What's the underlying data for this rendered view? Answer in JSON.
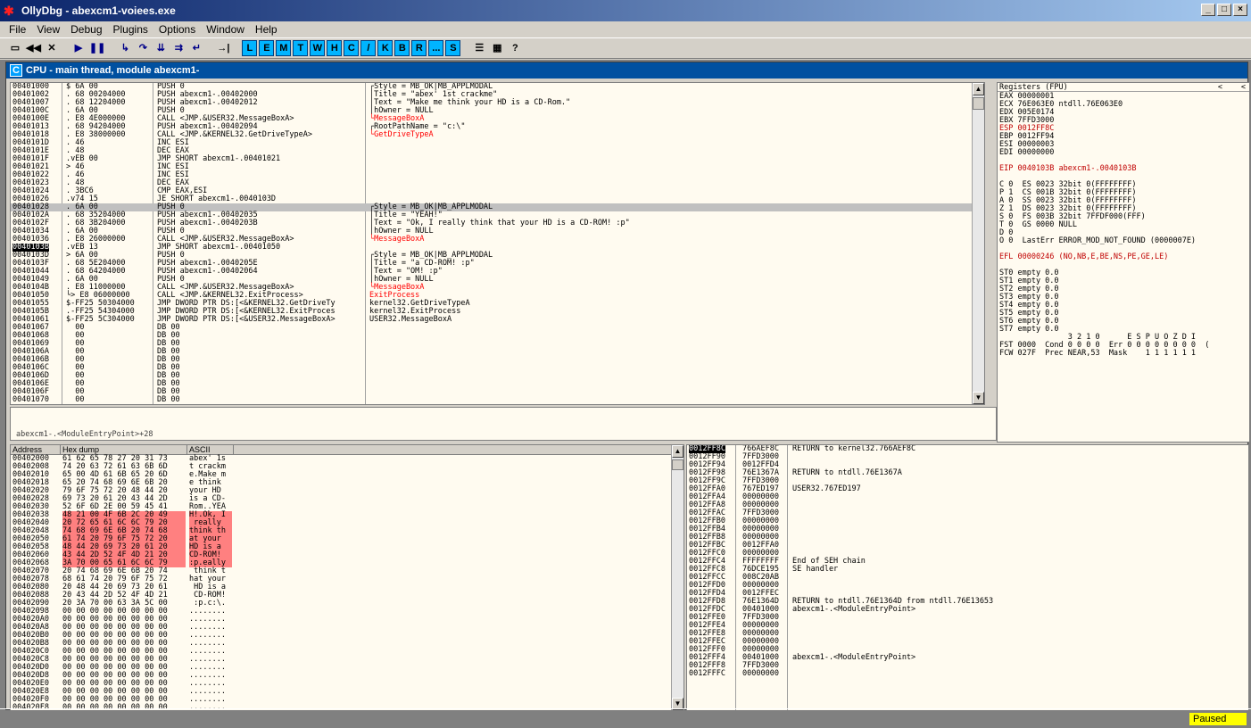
{
  "window": {
    "title": "OllyDbg - abexcm1-voiees.exe"
  },
  "menu": [
    "File",
    "View",
    "Debug",
    "Plugins",
    "Options",
    "Window",
    "Help"
  ],
  "toolbar": {
    "letters": [
      "L",
      "E",
      "M",
      "T",
      "W",
      "H",
      "C",
      "/",
      "K",
      "B",
      "R",
      "...",
      "S"
    ]
  },
  "cpu": {
    "title": "CPU - main thread, module abexcm1-",
    "icon": "C"
  },
  "disasm": {
    "rows": [
      {
        "addr": "00401000",
        "hex": "$ 6A 00",
        "asm": "PUSH 0",
        "cmt": "┌Style = MB_OK|MB_APPLMODAL"
      },
      {
        "addr": "00401002",
        "hex": ". 68 00204000",
        "asm": "PUSH abexcm1-.00402000",
        "cmt": "|Title = \"abex' 1st crackme\""
      },
      {
        "addr": "00401007",
        "hex": ". 68 12204000",
        "asm": "PUSH abexcm1-.00402012",
        "cmt": "|Text = \"Make me think your HD is a CD-Rom.\""
      },
      {
        "addr": "0040100C",
        "hex": ". 6A 00",
        "asm": "PUSH 0",
        "cmt": "|hOwner = NULL"
      },
      {
        "addr": "0040100E",
        "hex": ". E8 4E000000",
        "asm": "CALL <JMP.&USER32.MessageBoxA>",
        "cmt": "└MessageBoxA"
      },
      {
        "addr": "00401013",
        "hex": ". 68 94204000",
        "asm": "PUSH abexcm1-.00402094",
        "cmt": "┌RootPathName = \"c:\\\""
      },
      {
        "addr": "00401018",
        "hex": ". E8 38000000",
        "asm": "CALL <JMP.&KERNEL32.GetDriveTypeA>",
        "cmt": "└GetDriveTypeA"
      },
      {
        "addr": "0040101D",
        "hex": ". 46",
        "asm": "INC ESI",
        "cmt": ""
      },
      {
        "addr": "0040101E",
        "hex": ". 48",
        "asm": "DEC EAX",
        "cmt": ""
      },
      {
        "addr": "0040101F",
        "hex": ".vEB 00",
        "asm": "JMP SHORT abexcm1-.00401021",
        "cmt": ""
      },
      {
        "addr": "00401021",
        "hex": "> 46",
        "asm": "INC ESI",
        "cmt": ""
      },
      {
        "addr": "00401022",
        "hex": ". 46",
        "asm": "INC ESI",
        "cmt": ""
      },
      {
        "addr": "00401023",
        "hex": ". 48",
        "asm": "DEC EAX",
        "cmt": ""
      },
      {
        "addr": "00401024",
        "hex": ". 3BC6",
        "asm": "CMP EAX,ESI",
        "cmt": ""
      },
      {
        "addr": "00401026",
        "hex": ".v74 15",
        "asm": "JE SHORT abexcm1-.0040103D",
        "cmt": ""
      },
      {
        "addr": "00401028",
        "hex": ". 6A 00",
        "asm": "PUSH 0",
        "cmt": "┌Style = MB_OK|MB_APPLMODAL"
      },
      {
        "addr": "0040102A",
        "hex": ". 68 35204000",
        "asm": "PUSH abexcm1-.00402035",
        "cmt": "|Title = \"YEAH!\""
      },
      {
        "addr": "0040102F",
        "hex": ". 68 3B204000",
        "asm": "PUSH abexcm1-.0040203B",
        "cmt": "|Text = \"Ok, I really think that your HD is a CD-ROM! :p\""
      },
      {
        "addr": "00401034",
        "hex": ". 6A 00",
        "asm": "PUSH 0",
        "cmt": "|hOwner = NULL"
      },
      {
        "addr": "00401036",
        "hex": ". E8 26000000",
        "asm": "CALL <JMP.&USER32.MessageBoxA>",
        "cmt": "└MessageBoxA"
      },
      {
        "addr": "0040103B",
        "hex": ".vEB 13",
        "asm": "JMP SHORT abexcm1-.00401050",
        "cmt": ""
      },
      {
        "addr": "0040103D",
        "hex": "> 6A 00",
        "asm": "PUSH 0",
        "cmt": "┌Style = MB_OK|MB_APPLMODAL"
      },
      {
        "addr": "0040103F",
        "hex": ". 68 5E204000",
        "asm": "PUSH abexcm1-.0040205E",
        "cmt": "|Title = \"a CD-ROM! :p\""
      },
      {
        "addr": "00401044",
        "hex": ". 68 64204000",
        "asm": "PUSH abexcm1-.00402064",
        "cmt": "|Text = \"OM! :p\""
      },
      {
        "addr": "00401049",
        "hex": ". 6A 00",
        "asm": "PUSH 0",
        "cmt": "|hOwner = NULL"
      },
      {
        "addr": "0040104B",
        "hex": ". E8 11000000",
        "asm": "CALL <JMP.&USER32.MessageBoxA>",
        "cmt": "└MessageBoxA"
      },
      {
        "addr": "00401050",
        "hex": "└> E8 06000000",
        "asm": "CALL <JMP.&KERNEL32.ExitProcess>",
        "cmt": "ExitProcess"
      },
      {
        "addr": "00401055",
        "hex": "$-FF25 50304000",
        "asm": "JMP DWORD PTR DS:[<&KERNEL32.GetDriveTy",
        "cmt": "kernel32.GetDriveTypeA"
      },
      {
        "addr": "0040105B",
        "hex": ".-FF25 54304000",
        "asm": "JMP DWORD PTR DS:[<&KERNEL32.ExitProces",
        "cmt": "kernel32.ExitProcess"
      },
      {
        "addr": "00401061",
        "hex": "$-FF25 5C304000",
        "asm": "JMP DWORD PTR DS:[<&USER32.MessageBoxA>",
        "cmt": "USER32.MessageBoxA"
      },
      {
        "addr": "00401067",
        "hex": "  00",
        "asm": "DB 00",
        "cmt": ""
      },
      {
        "addr": "00401068",
        "hex": "  00",
        "asm": "DB 00",
        "cmt": ""
      },
      {
        "addr": "00401069",
        "hex": "  00",
        "asm": "DB 00",
        "cmt": ""
      },
      {
        "addr": "0040106A",
        "hex": "  00",
        "asm": "DB 00",
        "cmt": ""
      },
      {
        "addr": "0040106B",
        "hex": "  00",
        "asm": "DB 00",
        "cmt": ""
      },
      {
        "addr": "0040106C",
        "hex": "  00",
        "asm": "DB 00",
        "cmt": ""
      },
      {
        "addr": "0040106D",
        "hex": "  00",
        "asm": "DB 00",
        "cmt": ""
      },
      {
        "addr": "0040106E",
        "hex": "  00",
        "asm": "DB 00",
        "cmt": ""
      },
      {
        "addr": "0040106F",
        "hex": "  00",
        "asm": "DB 00",
        "cmt": ""
      },
      {
        "addr": "00401070",
        "hex": "  00",
        "asm": "DB 00",
        "cmt": ""
      }
    ]
  },
  "info": {
    "text": "abexcm1-.<ModuleEntryPoint>+28"
  },
  "registers": {
    "header": "Registers (FPU)",
    "lines": [
      "EAX 00000001",
      "ECX 76E063E0 ntdll.76E063E0",
      "EDX 005E0174",
      "EBX 7FFD3000",
      "ESP 0012FF8C",
      "EBP 0012FF94",
      "ESI 00000003",
      "EDI 00000000",
      "",
      "EIP 0040103B abexcm1-.0040103B",
      "",
      "C 0  ES 0023 32bit 0(FFFFFFFF)",
      "P 1  CS 001B 32bit 0(FFFFFFFF)",
      "A 0  SS 0023 32bit 0(FFFFFFFF)",
      "Z 1  DS 0023 32bit 0(FFFFFFFF)",
      "S 0  FS 003B 32bit 7FFDF000(FFF)",
      "T 0  GS 0000 NULL",
      "D 0",
      "O 0  LastErr ERROR_MOD_NOT_FOUND (0000007E)",
      "",
      "EFL 00000246 (NO,NB,E,BE,NS,PE,GE,LE)",
      "",
      "ST0 empty 0.0",
      "ST1 empty 0.0",
      "ST2 empty 0.0",
      "ST3 empty 0.0",
      "ST4 empty 0.0",
      "ST5 empty 0.0",
      "ST6 empty 0.0",
      "ST7 empty 0.0",
      "               3 2 1 0      E S P U O Z D I",
      "FST 0000  Cond 0 0 0 0  Err 0 0 0 0 0 0 0 0  (",
      "FCW 027F  Prec NEAR,53  Mask    1 1 1 1 1 1"
    ]
  },
  "dump": {
    "headers": [
      "Address",
      "Hex dump",
      "ASCII"
    ],
    "rows": [
      [
        "00402000",
        "61 62 65 78 27 20 31 73",
        "abex' 1s"
      ],
      [
        "00402008",
        "74 20 63 72 61 63 6B 6D",
        "t crackm"
      ],
      [
        "00402010",
        "65 00 4D 61 6B 65 20 6D",
        "e.Make m"
      ],
      [
        "00402018",
        "65 20 74 68 69 6E 6B 20",
        "e think "
      ],
      [
        "00402020",
        "79 6F 75 72 20 48 44 20",
        "your HD "
      ],
      [
        "00402028",
        "69 73 20 61 20 43 44 2D",
        "is a CD-"
      ],
      [
        "00402030",
        "52 6F 6D 2E 00 59 45 41",
        "Rom..YEA"
      ],
      [
        "00402038",
        "48 21 00 4F 6B 2C 20 49",
        "H!.Ok, I"
      ],
      [
        "00402040",
        "20 72 65 61 6C 6C 79 20",
        " really "
      ],
      [
        "00402048",
        "74 68 69 6E 6B 20 74 68",
        "think th"
      ],
      [
        "00402050",
        "61 74 20 79 6F 75 72 20",
        "at your "
      ],
      [
        "00402058",
        "48 44 20 69 73 20 61 20",
        "HD is a "
      ],
      [
        "00402060",
        "43 44 2D 52 4F 4D 21 20",
        "CD-ROM! "
      ],
      [
        "00402068",
        "3A 70 00 65 61 6C 6C 79",
        ":p.eally"
      ],
      [
        "00402070",
        "20 74 68 69 6E 6B 20 74",
        " think t"
      ],
      [
        "00402078",
        "68 61 74 20 79 6F 75 72",
        "hat your"
      ],
      [
        "00402080",
        "20 48 44 20 69 73 20 61",
        " HD is a"
      ],
      [
        "00402088",
        "20 43 44 2D 52 4F 4D 21",
        " CD-ROM!"
      ],
      [
        "00402090",
        "20 3A 70 00 63 3A 5C 00",
        " :p.c:\\."
      ],
      [
        "00402098",
        "00 00 00 00 00 00 00 00",
        "........"
      ],
      [
        "004020A0",
        "00 00 00 00 00 00 00 00",
        "........"
      ],
      [
        "004020A8",
        "00 00 00 00 00 00 00 00",
        "........"
      ],
      [
        "004020B0",
        "00 00 00 00 00 00 00 00",
        "........"
      ],
      [
        "004020B8",
        "00 00 00 00 00 00 00 00",
        "........"
      ],
      [
        "004020C0",
        "00 00 00 00 00 00 00 00",
        "........"
      ],
      [
        "004020C8",
        "00 00 00 00 00 00 00 00",
        "........"
      ],
      [
        "004020D0",
        "00 00 00 00 00 00 00 00",
        "........"
      ],
      [
        "004020D8",
        "00 00 00 00 00 00 00 00",
        "........"
      ],
      [
        "004020E0",
        "00 00 00 00 00 00 00 00",
        "........"
      ],
      [
        "004020E8",
        "00 00 00 00 00 00 00 00",
        "........"
      ],
      [
        "004020F0",
        "00 00 00 00 00 00 00 00",
        "........"
      ],
      [
        "004020F8",
        "00 00 00 00 00 00 00 00",
        "........"
      ]
    ]
  },
  "stack": {
    "rows": [
      [
        "0012FF8C",
        "766AEF8C",
        "RETURN to kernel32.766AEF8C"
      ],
      [
        "0012FF90",
        "7FFD3000",
        ""
      ],
      [
        "0012FF94",
        "0012FFD4",
        ""
      ],
      [
        "0012FF98",
        "76E1367A",
        "RETURN to ntdll.76E1367A"
      ],
      [
        "0012FF9C",
        "7FFD3000",
        ""
      ],
      [
        "0012FFA0",
        "767ED197",
        "USER32.767ED197"
      ],
      [
        "0012FFA4",
        "00000000",
        ""
      ],
      [
        "0012FFA8",
        "00000000",
        ""
      ],
      [
        "0012FFAC",
        "7FFD3000",
        ""
      ],
      [
        "0012FFB0",
        "00000000",
        ""
      ],
      [
        "0012FFB4",
        "00000000",
        ""
      ],
      [
        "0012FFB8",
        "00000000",
        ""
      ],
      [
        "0012FFBC",
        "0012FFA0",
        ""
      ],
      [
        "0012FFC0",
        "00000000",
        ""
      ],
      [
        "0012FFC4",
        "FFFFFFFF",
        "End of SEH chain"
      ],
      [
        "0012FFC8",
        "76DCE195",
        "SE handler"
      ],
      [
        "0012FFCC",
        "008C20AB",
        ""
      ],
      [
        "0012FFD0",
        "00000000",
        ""
      ],
      [
        "0012FFD4",
        "0012FFEC",
        ""
      ],
      [
        "0012FFD8",
        "76E1364D",
        "RETURN to ntdll.76E1364D from ntdll.76E13653"
      ],
      [
        "0012FFDC",
        "00401000",
        "abexcm1-.<ModuleEntryPoint>"
      ],
      [
        "0012FFE0",
        "7FFD3000",
        ""
      ],
      [
        "0012FFE4",
        "00000000",
        ""
      ],
      [
        "0012FFE8",
        "00000000",
        ""
      ],
      [
        "0012FFEC",
        "00000000",
        ""
      ],
      [
        "0012FFF0",
        "00000000",
        ""
      ],
      [
        "0012FFF4",
        "00401000",
        "abexcm1-.<ModuleEntryPoint>"
      ],
      [
        "0012FFF8",
        "7FFD3000",
        ""
      ],
      [
        "0012FFFC",
        "00000000",
        ""
      ]
    ]
  },
  "status": {
    "text": "Paused"
  }
}
